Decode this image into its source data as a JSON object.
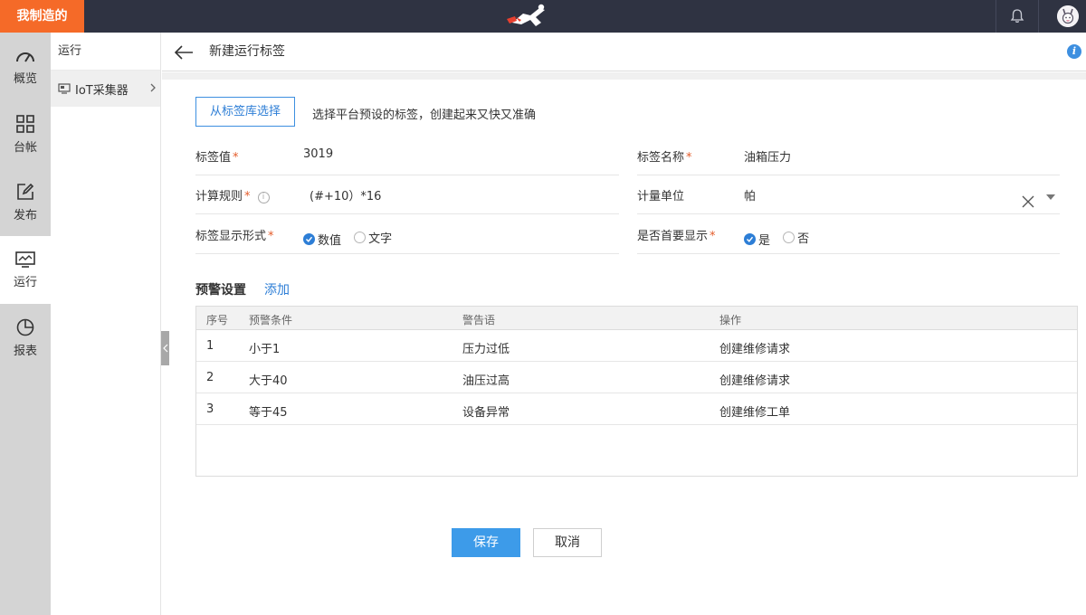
{
  "topbar": {
    "brand": "我制造的",
    "logo_icon": "runner-logo-icon",
    "bell_icon": "bell-icon",
    "avatar_icon": "user-avatar-icon",
    "colors": {
      "bar": "#2f3342",
      "brand": "#f56a28"
    }
  },
  "nav": {
    "items": [
      {
        "label": "概览",
        "icon": "gauge-icon",
        "active": false
      },
      {
        "label": "台帐",
        "icon": "grid-icon",
        "active": false
      },
      {
        "label": "发布",
        "icon": "edit-icon",
        "active": false
      },
      {
        "label": "运行",
        "icon": "monitor-icon",
        "active": true
      },
      {
        "label": "报表",
        "icon": "pie-chart-icon",
        "active": false
      }
    ]
  },
  "subnav": {
    "title": "运行",
    "items": [
      {
        "label": "IoT采集器",
        "icon": "iot-device-icon"
      }
    ]
  },
  "header": {
    "title": "新建运行标签",
    "back_icon": "arrow-left-icon",
    "info_icon": "info-icon",
    "info_glyph": "i"
  },
  "form": {
    "library_button": "从标签库选择",
    "library_hint": "选择平台预设的标签，创建起来又快又准确",
    "required_mark": "*",
    "tag_value": {
      "label": "标签值",
      "value": "3019"
    },
    "tag_name": {
      "label": "标签名称",
      "value": "油箱压力"
    },
    "calc_rule": {
      "label": "计算规则",
      "value": "(#+10）*16",
      "info_glyph": "i"
    },
    "unit": {
      "label": "计量单位",
      "value": "帕"
    },
    "display_form": {
      "label": "标签显示形式",
      "options": [
        "数值",
        "文字"
      ],
      "selected": "数值"
    },
    "primary_display": {
      "label": "是否首要显示",
      "options": [
        "是",
        "否"
      ],
      "selected": "是"
    }
  },
  "warnings": {
    "title": "预警设置",
    "add_label": "添加",
    "columns": [
      "序号",
      "预警条件",
      "警告语",
      "操作"
    ],
    "rows": [
      [
        "1",
        "小于1",
        "压力过低",
        "创建维修请求"
      ],
      [
        "2",
        "大于40",
        "油压过高",
        "创建维修请求"
      ],
      [
        "3",
        "等于45",
        "设备异常",
        "创建维修工单"
      ]
    ]
  },
  "actions": {
    "save": "保存",
    "cancel": "取消",
    "colors": {
      "primary": "#3d9be9",
      "link": "#2d7ed6",
      "required": "#e45c2a"
    }
  }
}
